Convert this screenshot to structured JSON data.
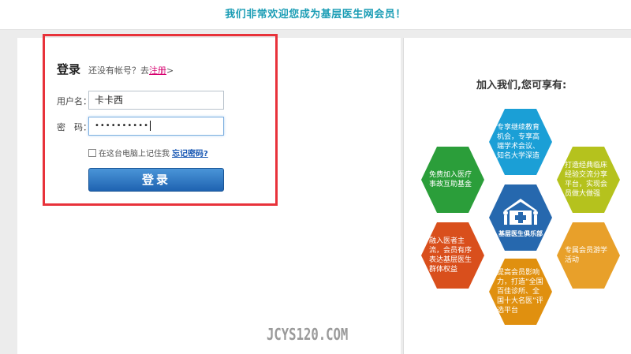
{
  "header": {
    "welcome": "我们非常欢迎您成为基层医生网会员！"
  },
  "login": {
    "title": "登录",
    "no_account_text": "还没有帐号？去",
    "register_link": "注册",
    "register_suffix": ">",
    "username_label": "用户名：",
    "username_value": "卡卡西",
    "password_label": "密　码：",
    "password_value": "••••••••••",
    "remember_label": "在这台电脑上记住我",
    "forgot_link": "忘记密码?",
    "submit_label": "登录"
  },
  "benefits": {
    "title": "加入我们,您可享有:",
    "center_label": "基层医生俱乐部",
    "items": [
      {
        "text": "专享继续教育机会，专享高端学术会议、知名大学深造",
        "color": "#1b9fd6"
      },
      {
        "text": "打造经典临床经验交流分享平台，实现会员做大做强",
        "color": "#b5c21d"
      },
      {
        "text": "专属会员游学活动",
        "color": "#e8a02a"
      },
      {
        "text": "提高会员影响力，打造“全国百佳诊所、全国十大名医”评选平台",
        "color": "#e0900f"
      },
      {
        "text": "融入医者主流，会员有序表达基层医生群体权益",
        "color": "#d94f1c"
      },
      {
        "text": "免费加入医疗事故互助基金",
        "color": "#2b9e3a"
      }
    ],
    "center_color": "#2668ae"
  },
  "watermark": "JCYS120.COM"
}
